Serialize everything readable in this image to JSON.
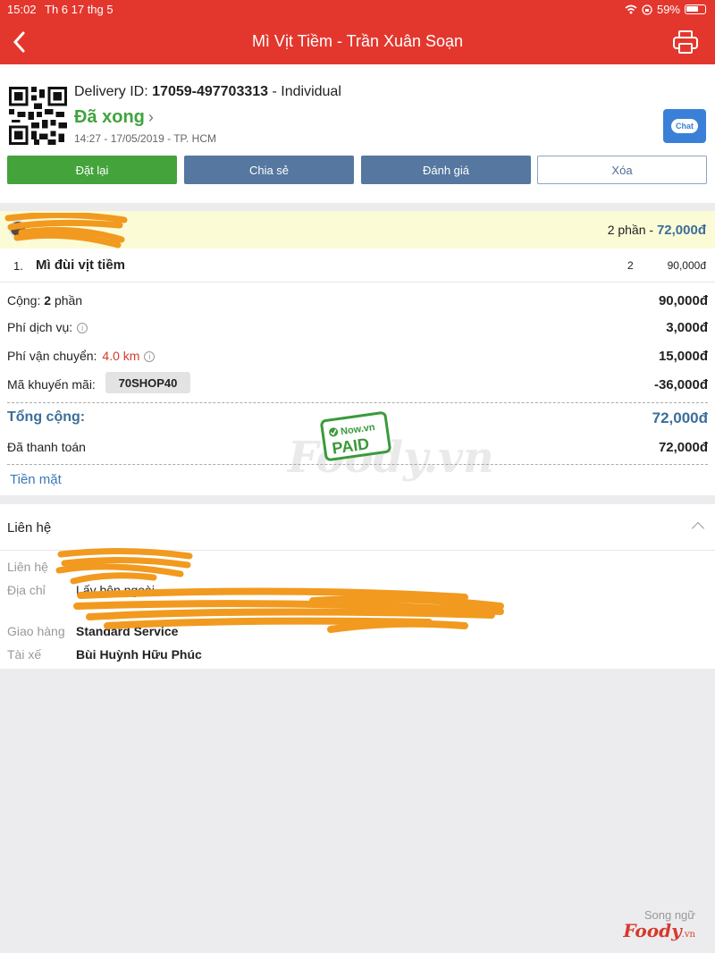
{
  "status_bar": {
    "time": "15:02",
    "date": "Th 6 17 thg 5",
    "battery": "59%"
  },
  "navbar": {
    "title": "Mì Vịt Tiềm - Trần Xuân Soạn"
  },
  "order_header": {
    "delivery_label": "Delivery ID:",
    "delivery_id": "17059-497703313",
    "delivery_type": "- Individual",
    "status": "Đã xong",
    "datetime": "14:27 - 17/05/2019 - TP. HCM",
    "chat_label": "Chat"
  },
  "actions": {
    "reorder": "Đặt lại",
    "share": "Chia sẻ",
    "rate": "Đánh giá",
    "delete": "Xóa"
  },
  "shop_row": {
    "count_text": "2 phần -",
    "total": "72,000đ"
  },
  "items": [
    {
      "index": "1.",
      "name": "Mì đùi vịt tiềm",
      "qty": "2",
      "price": "90,000đ"
    }
  ],
  "summary": {
    "subtotal_label": "Cộng:",
    "subtotal_count": "2",
    "subtotal_unit": "phần",
    "subtotal_value": "90,000đ",
    "service_fee_label": "Phí dịch vụ:",
    "service_fee_value": "3,000đ",
    "shipping_label": "Phí vận chuyển:",
    "shipping_distance": "4.0 km",
    "shipping_value": "15,000đ",
    "promo_label": "Mã khuyến mãi:",
    "promo_code": "70SHOP40",
    "promo_value": "-36,000đ",
    "total_label": "Tổng cộng:",
    "total_value": "72,000đ",
    "paid_label": "Đã thanh toán",
    "paid_value": "72,000đ",
    "payment_method": "Tiền mặt"
  },
  "stamp": {
    "brand": "Now.vn",
    "text": "PAID"
  },
  "watermark": "Foody.vn",
  "contact": {
    "section_title": "Liên hệ",
    "contact_label": "Liên hệ",
    "address_label": "Địa chỉ",
    "address_line1": "Lấy bên ngoài",
    "delivery_label": "Giao hàng",
    "delivery_value": "Standard Service",
    "driver_label": "Tài xế",
    "driver_value": "Bùi Huỳnh Hữu Phúc"
  },
  "brand_badge": {
    "line1": "Song ngữ",
    "line2": "Foody",
    "suffix": ".vn"
  }
}
